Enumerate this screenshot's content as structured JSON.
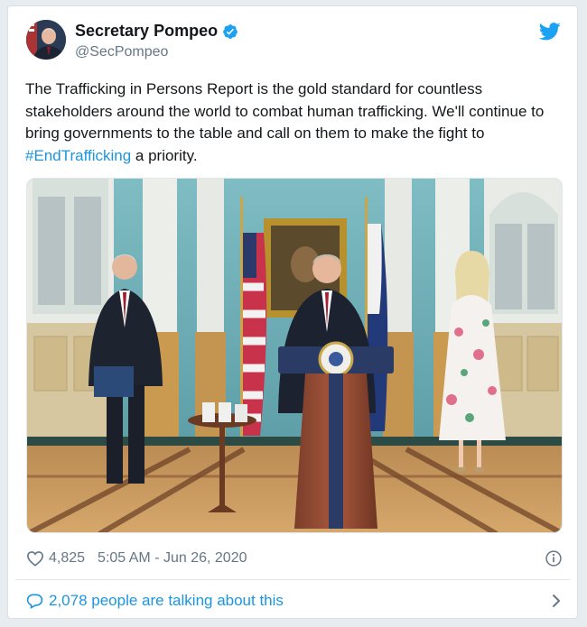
{
  "tweet": {
    "author": {
      "display_name": "Secretary Pompeo",
      "handle": "@SecPompeo",
      "verified": true
    },
    "text_before": "The Trafficking in Persons Report is the gold standard for countless stakeholders around the world to combat human trafficking. We'll continue to bring governments to the table and call on them to make the fight to ",
    "hashtag": "#EndTrafficking",
    "text_after": " a priority.",
    "likes": "4,825",
    "timestamp": "5:05 AM - Jun 26, 2020",
    "talking_about": "2,078 people are talking about this"
  },
  "icons": {
    "brand": "twitter-bird-icon",
    "verified": "verified-badge-icon",
    "like": "heart-icon",
    "info": "info-icon",
    "reply": "speech-bubble-icon",
    "more": "chevron-right-icon"
  },
  "colors": {
    "brand_blue": "#1da1f2",
    "link_blue": "#1b95e0",
    "text": "#14171a",
    "muted": "#657786"
  }
}
